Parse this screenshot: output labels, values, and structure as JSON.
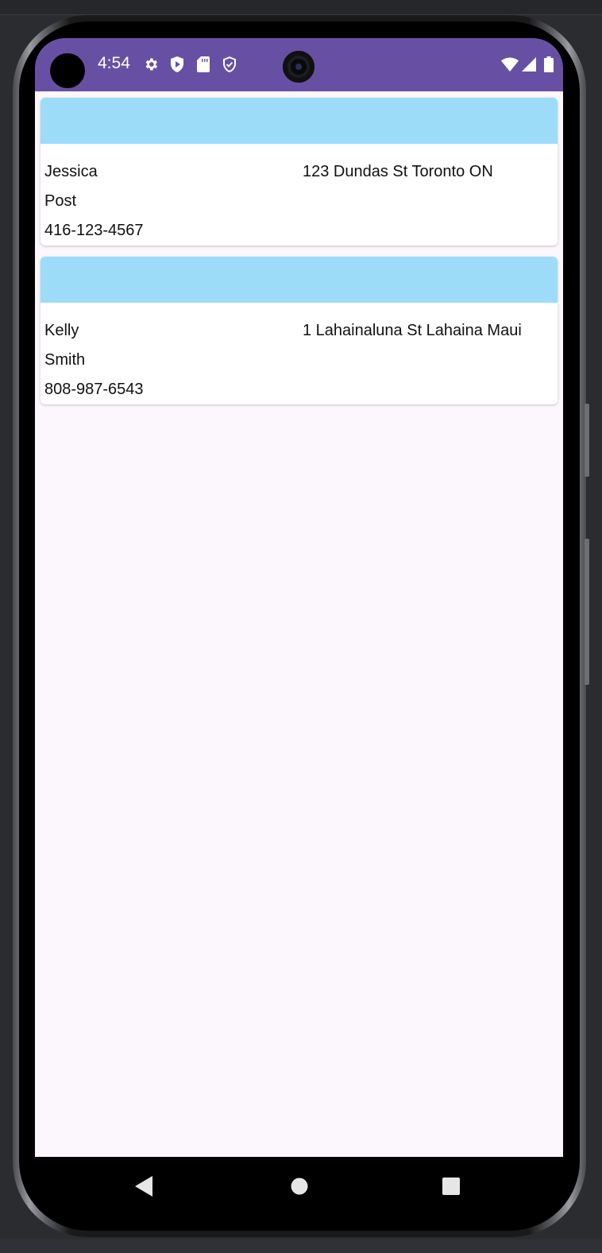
{
  "status_bar": {
    "time": "4:54",
    "background": "#6750a4",
    "left_icons": [
      "settings-icon",
      "shield-play-icon",
      "sd-card-icon",
      "shield-outline-icon"
    ],
    "right_icons": [
      "wifi-icon",
      "signal-icon",
      "battery-icon"
    ]
  },
  "contacts": [
    {
      "first_name": "Jessica",
      "last_name": "Post",
      "phone": "416-123-4567",
      "address": "123 Dundas St Toronto ON"
    },
    {
      "first_name": "Kelly",
      "last_name": "Smith",
      "phone": "808-987-6543",
      "address": "1 Lahainaluna St Lahaina Maui"
    }
  ],
  "colors": {
    "card_header": "#9cdcf9",
    "screen_background": "#fcf7fd",
    "card_background": "#ffffff"
  },
  "nav_bar": {
    "buttons": [
      "back-icon",
      "home-icon",
      "recents-icon"
    ]
  }
}
